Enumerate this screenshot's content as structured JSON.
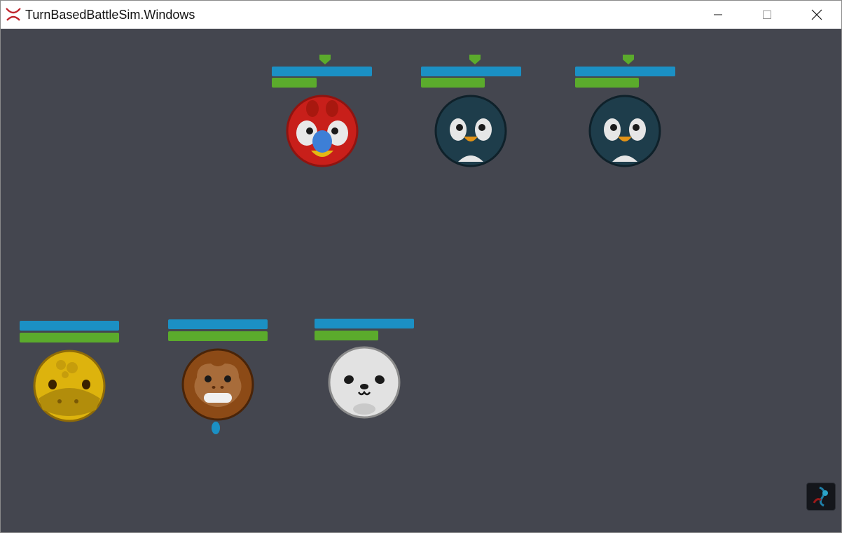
{
  "window": {
    "title": "TurnBasedBattleSim.Windows",
    "app_icon": "crossed-swords-icon",
    "controls": [
      "minimize-icon",
      "maximize-icon",
      "close-icon"
    ]
  },
  "colors": {
    "background": "#44464f",
    "energy_bar": "#1b90c4",
    "health_bar": "#5bab2c",
    "enemy_marker": "#5bab2c",
    "turn_marker": "#1b90c4"
  },
  "enemies": [
    {
      "name": "parrot",
      "icon": "parrot-icon",
      "energy": 1.0,
      "health": 0.45,
      "marker": "shield-marker-icon"
    },
    {
      "name": "penguin",
      "icon": "penguin-icon",
      "energy": 1.0,
      "health": 0.64,
      "marker": "shield-marker-icon"
    },
    {
      "name": "penguin",
      "icon": "penguin-icon",
      "energy": 1.0,
      "health": 0.64,
      "marker": "shield-marker-icon"
    }
  ],
  "allies": [
    {
      "name": "sloth",
      "icon": "sloth-icon",
      "energy": 1.0,
      "health": 1.0
    },
    {
      "name": "monkey",
      "icon": "monkey-icon",
      "energy": 1.0,
      "health": 1.0,
      "marker": "active-turn-drop-icon"
    },
    {
      "name": "seal",
      "icon": "seal-icon",
      "energy": 1.0,
      "health": 0.64
    }
  ],
  "corner_button": {
    "icon": "ability-card-icon"
  }
}
